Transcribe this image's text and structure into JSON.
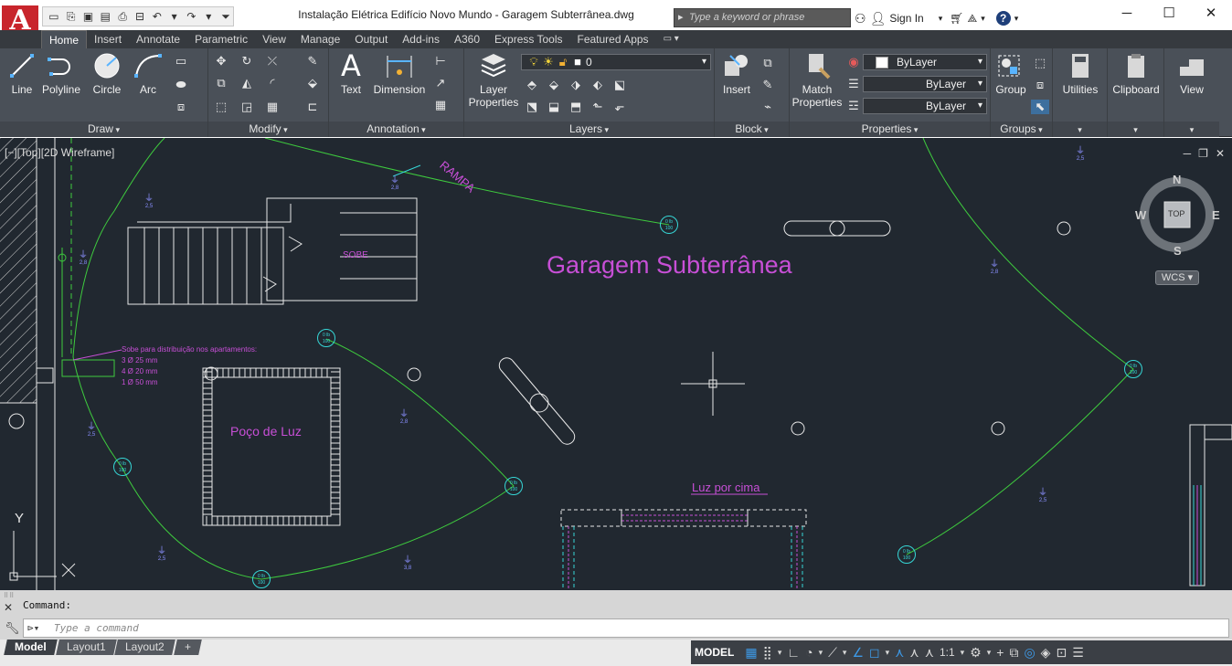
{
  "title_bar": {
    "document_title": "Instalação Elétrica Edifício Novo Mundo - Garagem Subterrânea.dwg",
    "search_placeholder": "Type a keyword or phrase",
    "sign_in": "Sign In",
    "app_letter": "A"
  },
  "tabs": [
    "Home",
    "Insert",
    "Annotate",
    "Parametric",
    "View",
    "Manage",
    "Output",
    "Add-ins",
    "A360",
    "Express Tools",
    "Featured Apps"
  ],
  "active_tab": "Home",
  "ribbon": {
    "draw": {
      "title": "Draw",
      "line": "Line",
      "polyline": "Polyline",
      "circle": "Circle",
      "arc": "Arc"
    },
    "modify": {
      "title": "Modify"
    },
    "annotation": {
      "title": "Annotation",
      "text": "Text",
      "dimension": "Dimension"
    },
    "layers": {
      "title": "Layers",
      "layer_properties": "Layer Properties",
      "current_layer": "0"
    },
    "block": {
      "title": "Block",
      "insert": "Insert"
    },
    "properties": {
      "title": "Properties",
      "match_properties": "Match Properties",
      "color": "ByLayer",
      "linetype": "ByLayer",
      "lineweight": "ByLayer"
    },
    "groups": {
      "title": "Groups",
      "group": "Group"
    },
    "utilities": {
      "label": "Utilities"
    },
    "clipboard": {
      "label": "Clipboard"
    },
    "view": {
      "label": "View"
    }
  },
  "viewport": {
    "label": "[−][Top][2D Wireframe]",
    "viewcube_face": "TOP",
    "compass": {
      "n": "N",
      "s": "S",
      "e": "E",
      "w": "W"
    },
    "wcs": "WCS"
  },
  "drawing": {
    "title": "Garagem Subterrânea",
    "rampa": "RAMPA",
    "sobe": "SOBE",
    "poco_de_luz": "Poço de Luz",
    "luz_por_cima": "Luz por cima",
    "note_line1": "Sobe para distribuição nos apartamentos:",
    "note_line2": "3 Ø 25 mm",
    "note_line3": "4 Ø 20 mm",
    "note_line4": "1 Ø 50 mm",
    "axis_y": "Y",
    "fixture_label_top": "0 lb",
    "fixture_label_bottom": "100",
    "outlet_labels": [
      "2,5",
      "2,8",
      "2,8",
      "2,5",
      "2,8",
      "2,5",
      "3,8",
      "2,5",
      "2,8"
    ]
  },
  "command": {
    "history": "Command:",
    "placeholder": "Type a command"
  },
  "status": {
    "layout_tabs": [
      "Model",
      "Layout1",
      "Layout2"
    ],
    "active_layout": "Model",
    "model": "MODEL",
    "scale": "1:1"
  },
  "colors": {
    "canvas_bg": "#212830",
    "ribbon_bg": "#4a5058",
    "green_lines": "#3ecb3e",
    "cyan_fixtures": "#36d6d6",
    "magenta_text": "#c74fd6",
    "white_geometry": "#e8e8e8"
  }
}
